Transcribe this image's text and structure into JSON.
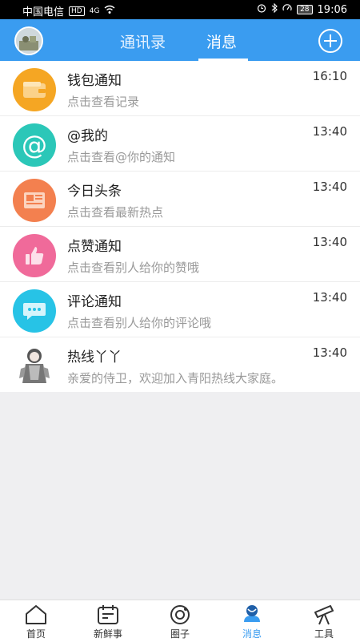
{
  "status_bar": {
    "carrier": "中国电信",
    "hd_badge": "HD",
    "network": "4G",
    "battery": "28",
    "time": "19:06"
  },
  "header": {
    "tabs": [
      {
        "label": "通讯录",
        "active": false
      },
      {
        "label": "消息",
        "active": true
      }
    ],
    "accent_color": "#3a9cf0"
  },
  "messages": [
    {
      "title": "钱包通知",
      "subtitle": "点击查看记录",
      "time": "16:10",
      "icon": "wallet-icon",
      "color": "#f5a623"
    },
    {
      "title": "@我的",
      "subtitle": "点击查看@你的通知",
      "time": "13:40",
      "icon": "at-icon",
      "color": "#2bc7b8"
    },
    {
      "title": "今日头条",
      "subtitle": "点击查看最新热点",
      "time": "13:40",
      "icon": "newspaper-icon",
      "color": "#f3804f"
    },
    {
      "title": "点赞通知",
      "subtitle": "点击查看别人给你的赞哦",
      "time": "13:40",
      "icon": "thumbs-up-icon",
      "color": "#f06a9a"
    },
    {
      "title": "评论通知",
      "subtitle": "点击查看别人给你的评论哦",
      "time": "13:40",
      "icon": "comment-icon",
      "color": "#27c3e6"
    },
    {
      "title": "热线丫丫",
      "subtitle": "亲爱的侍卫，欢迎加入青阳热线大家庭。",
      "time": "13:40",
      "icon": "character-avatar-icon",
      "color": "#ffffff"
    }
  ],
  "bottom_nav": [
    {
      "label": "首页",
      "icon": "home-icon",
      "active": false
    },
    {
      "label": "新鲜事",
      "icon": "calendar-icon",
      "active": false
    },
    {
      "label": "圈子",
      "icon": "circle-icon",
      "active": false
    },
    {
      "label": "消息",
      "icon": "message-icon",
      "active": true
    },
    {
      "label": "工具",
      "icon": "telescope-icon",
      "active": false
    }
  ]
}
